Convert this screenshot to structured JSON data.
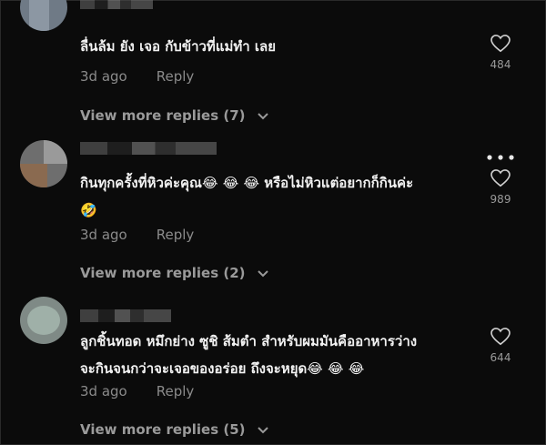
{
  "comments": [
    {
      "text": "ลื่นล้ม ยัง เจอ กับข้าวที่แม่ทำ เลย",
      "time": "3d ago",
      "reply": "Reply",
      "likes": "484",
      "more_replies": "View more replies (7)"
    },
    {
      "text_line1": "กินทุกครั้งที่หิวค่ะคุณ😂 😂 😂 หรือไม่หิวแต่อยากก็กินค่ะ",
      "text_line2": "🤣",
      "time": "3d ago",
      "reply": "Reply",
      "likes": "989",
      "more_replies": "View more replies (2)"
    },
    {
      "text_line1": "ลูกชิ้นทอด หมึกย่าง ซูชิ ส้มตำ สำหรับผมมันคืออาหารว่าง",
      "text_line2": "จะกินจนกว่าจะเจอของอร่อย ถึงจะหยุด😂 😂 😂",
      "time": "3d ago",
      "reply": "Reply",
      "likes": "644",
      "more_replies": "View more replies (5)"
    }
  ],
  "icons": {
    "heart": "heart-outline-icon",
    "more": "more-horizontal-icon",
    "chevron": "chevron-down-icon"
  },
  "colors": {
    "background": "#0b0b0b",
    "text": "#f2f2f2",
    "muted": "#8b8b8b"
  }
}
